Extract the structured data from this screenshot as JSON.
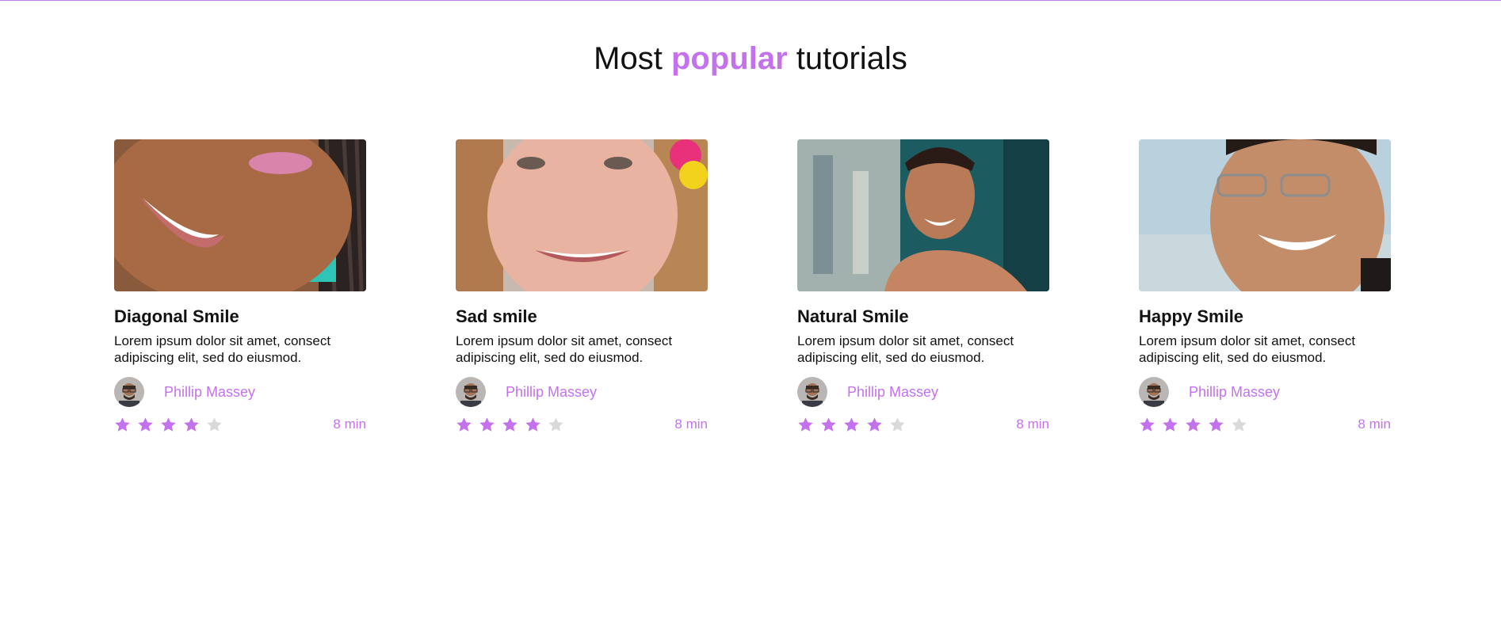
{
  "header": {
    "title_before": "Most",
    "title_accent": "popular",
    "title_after": "tutorials"
  },
  "colors": {
    "accent": "#c471ed",
    "star_filled": "#c471ed",
    "star_empty": "#d9d9d9",
    "top_border": "#c77ee8"
  },
  "cards": [
    {
      "title": "Diagonal Smile",
      "description": "Lorem ipsum dolor sit amet, consect adipiscing elit, sed do eiusmod.",
      "author": "Phillip Massey",
      "rating": 4,
      "rating_max": 5,
      "duration": "8 min"
    },
    {
      "title": "Sad smile",
      "description": "Lorem ipsum dolor sit amet, consect adipiscing elit, sed do eiusmod.",
      "author": "Phillip Massey",
      "rating": 4,
      "rating_max": 5,
      "duration": "8 min"
    },
    {
      "title": "Natural Smile",
      "description": "Lorem ipsum dolor sit amet, consect adipiscing elit, sed do eiusmod.",
      "author": "Phillip Massey",
      "rating": 4,
      "rating_max": 5,
      "duration": "8 min"
    },
    {
      "title": "Happy Smile",
      "description": "Lorem ipsum dolor sit amet, consect adipiscing elit, sed do eiusmod.",
      "author": "Phillip Massey",
      "rating": 4,
      "rating_max": 5,
      "duration": "8 min"
    }
  ]
}
